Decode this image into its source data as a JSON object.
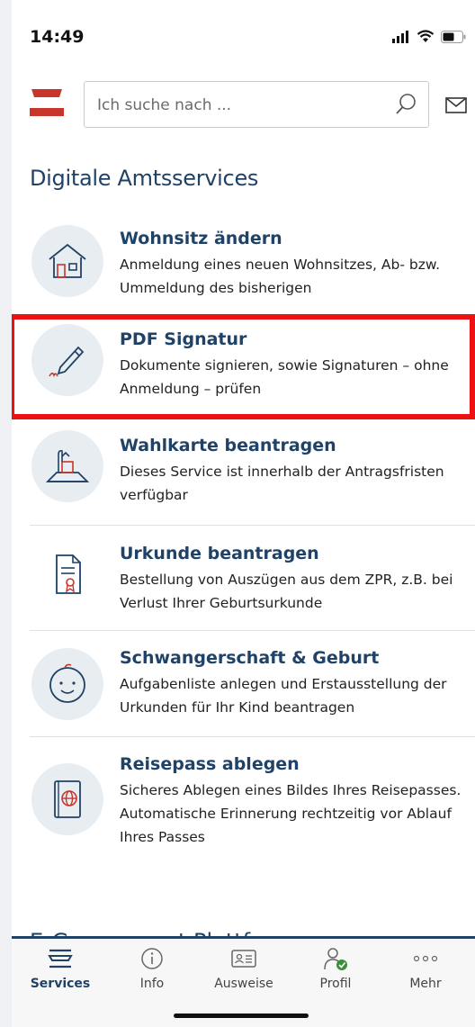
{
  "status_bar": {
    "time": "14:49"
  },
  "search": {
    "placeholder": "Ich suche nach ..."
  },
  "section_title": "Digitale Amtsservices",
  "services": [
    {
      "title": "Wohnsitz ändern",
      "desc": "Anmeldung eines neuen Wohnsitzes, Ab- bzw. Ummeldung des bisherigen",
      "icon": "house-icon"
    },
    {
      "title": "PDF Signatur",
      "desc": "Dokumente signieren, sowie Signaturen – ohne Anmeldung – prüfen",
      "icon": "pen-signature-icon"
    },
    {
      "title": "Wahlkarte beantragen",
      "desc": "Dieses Service ist innerhalb der Antragsfristen verfügbar",
      "icon": "ballot-box-icon"
    },
    {
      "title": "Urkunde beantragen",
      "desc": "Bestellung von Auszügen aus dem ZPR, z.B. bei Verlust Ihrer Geburtsurkunde",
      "icon": "certificate-icon"
    },
    {
      "title": "Schwangerschaft & Geburt",
      "desc": "Aufgabenliste anlegen und Erstausstellung der Urkunden für Ihr Kind beantragen",
      "icon": "baby-face-icon"
    },
    {
      "title": "Reisepass ablegen",
      "desc": "Sicheres Ablegen eines Bildes Ihres Reisepasses. Automatische Erinnerung rechtzeitig vor Ablauf Ihres Passes",
      "icon": "passport-icon"
    }
  ],
  "next_section_title": "E-Government Plattformen",
  "tabs": [
    {
      "label": "Services",
      "icon": "services-icon",
      "active": true
    },
    {
      "label": "Info",
      "icon": "info-icon",
      "active": false
    },
    {
      "label": "Ausweise",
      "icon": "id-card-icon",
      "active": false
    },
    {
      "label": "Profil",
      "icon": "profile-icon",
      "active": false
    },
    {
      "label": "Mehr",
      "icon": "more-icon",
      "active": false
    }
  ],
  "colors": {
    "primary": "#1f4266",
    "accent": "#c8352b",
    "highlight": "#ee1111",
    "icon_bg": "#e8edf2"
  }
}
